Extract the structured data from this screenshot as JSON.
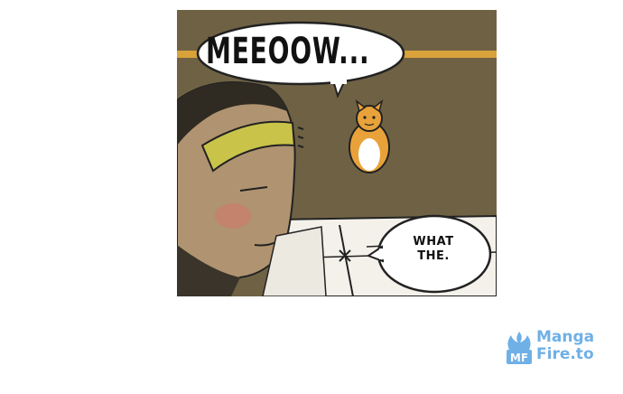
{
  "panel": {
    "speech_cat": "MEEOOW...",
    "speech_man": "WHAT\nTHE."
  },
  "watermark": {
    "line1": "Manga",
    "line2": "Fire.to",
    "icon_letters": "MF"
  },
  "colors": {
    "background": "#6f6244",
    "cat_orange": "#e9a23a",
    "headband": "#c9c34a",
    "stripe": "#d9a23a",
    "watermark_blue": "#6fb0e6"
  }
}
